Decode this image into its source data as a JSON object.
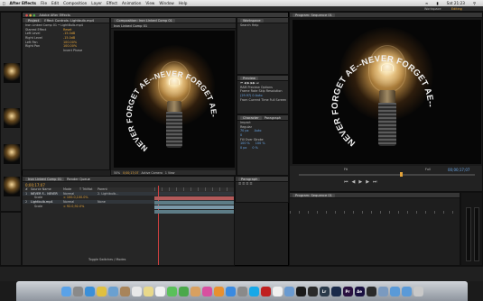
{
  "menubar": {
    "app": "After Effects",
    "items": [
      "File",
      "Edit",
      "Composition",
      "Layer",
      "Effect",
      "Animation",
      "View",
      "Window",
      "Help"
    ],
    "clock": "Sat 21:23"
  },
  "app_title": "Adobe After Effects",
  "workspace_label": "Workspace",
  "project_panel": {
    "title": "Project",
    "effect_tab": "Effect Controls: Lightbulb.mp4",
    "rows": [
      {
        "label": "Iron Linked Comp 01 • LightBulb.mp4",
        "value": ""
      },
      {
        "label": "Starred Effect",
        "value": "Reset"
      },
      {
        "label": "Left Level",
        "value": "-15.0dB"
      },
      {
        "label": "Right Level",
        "value": "-15.0dB"
      },
      {
        "label": "Left Pan",
        "value": "100.00%"
      },
      {
        "label": "Right Pan",
        "value": "100.00%"
      },
      {
        "label": "",
        "value": "Invert Phase"
      }
    ]
  },
  "comp_viewer": {
    "tab": "Composition: Iron Linked Comp 01",
    "sub_tab": "Iron Linked Comp 01",
    "arc_text": "NEVER FORGET AE--NEVER FORGET AE--NEVER",
    "zoom": "50%",
    "timecode": "0;00;17;07",
    "view": "Active Camera",
    "views": "1 View"
  },
  "info_panel": {
    "title": "Workspace",
    "rows": [
      "Search Help"
    ]
  },
  "preview_panel": {
    "title": "Preview",
    "rows": [
      "RAM Preview Options",
      "Frame Rate  Skip  Resolution",
      "(29.97)  0  Auto",
      "From Current Time   Full Screen"
    ]
  },
  "char_panel": {
    "title": "Character",
    "tab2": "Paragraph",
    "font": "Impact",
    "style": "Regular",
    "size": "70 px",
    "leading": "Auto",
    "tracking": "0",
    "stroke": "Fill Over Stroke",
    "scale_v": "100 %",
    "scale_h": "100 %",
    "baseline": "0 px",
    "tsume": "0 %"
  },
  "timeline": {
    "tab": "Iron Linked Comp 01",
    "tab2": "Render Queue",
    "timecode": "0;00;17;07",
    "columns": [
      "#",
      "Source Name",
      "Mode",
      "T TrkMat",
      "Parent"
    ],
    "layers": [
      {
        "num": "1",
        "name": "NEVER F... NEVER",
        "mode": "Normal",
        "parent": "2. Lightbulb..."
      },
      {
        "num": "2",
        "name": "Lightbulb.mp4",
        "mode": "Normal",
        "parent": "None"
      }
    ],
    "sub_rows": [
      "Scale",
      "Scale"
    ],
    "sub_values": [
      "∞ 100.0,100.0%",
      "∞ 92.0,92.0%"
    ],
    "footer": "Toggle Switches / Modes"
  },
  "premiere": {
    "workspace": "Workspace",
    "editing": "Editing",
    "sequence_timecode": "00;00;17;07",
    "program_tab": "Program: Sequence 01",
    "fit": "Fit",
    "full": "Full"
  },
  "dock": {
    "items": [
      {
        "name": "finder-icon",
        "label": "",
        "color": "#5aa2e8"
      },
      {
        "name": "launchpad-icon",
        "label": "",
        "color": "#8a8a8a"
      },
      {
        "name": "safari-icon",
        "label": "",
        "color": "#3b8fd8"
      },
      {
        "name": "chrome-icon",
        "label": "",
        "color": "#e0c040"
      },
      {
        "name": "mail-icon",
        "label": "",
        "color": "#6aa0d0"
      },
      {
        "name": "contacts-icon",
        "label": "",
        "color": "#a8845a"
      },
      {
        "name": "calendar-icon",
        "label": "",
        "color": "#e8e8e8"
      },
      {
        "name": "notes-icon",
        "label": "",
        "color": "#e8d88a"
      },
      {
        "name": "reminders-icon",
        "label": "",
        "color": "#f2f2f2"
      },
      {
        "name": "messages-icon",
        "label": "",
        "color": "#5ac05a"
      },
      {
        "name": "facetime-icon",
        "label": "",
        "color": "#4aa84a"
      },
      {
        "name": "photo-icon",
        "label": "",
        "color": "#d8a060"
      },
      {
        "name": "itunes-icon",
        "label": "",
        "color": "#d850a0"
      },
      {
        "name": "ibooks-icon",
        "label": "",
        "color": "#e89030"
      },
      {
        "name": "appstore-icon",
        "label": "",
        "color": "#3a8ae0"
      },
      {
        "name": "prefs-icon",
        "label": "",
        "color": "#8a8a8a"
      },
      {
        "name": "skype-icon",
        "label": "",
        "color": "#18a8e8"
      },
      {
        "name": "acrobat-icon",
        "label": "",
        "color": "#c02020"
      },
      {
        "name": "textedit-icon",
        "label": "",
        "color": "#f0f0f0"
      },
      {
        "name": "preview-icon",
        "label": "",
        "color": "#6a9ad0"
      },
      {
        "name": "terminal-icon",
        "label": "",
        "color": "#1a1a1a"
      },
      {
        "name": "activity-icon",
        "label": "",
        "color": "#2a2a2a"
      },
      {
        "name": "lightroom-icon",
        "label": "Lr",
        "color": "#2a3a4a"
      },
      {
        "name": "photoshop-icon",
        "label": "",
        "color": "#1a2a4a"
      },
      {
        "name": "premiere-icon",
        "label": "Pr",
        "color": "#2a1040"
      },
      {
        "name": "aftereffects-icon",
        "label": "Ae",
        "color": "#1a1040"
      },
      {
        "name": "media-encoder-icon",
        "label": "",
        "color": "#2a2a2a"
      },
      {
        "name": "downloads-icon",
        "label": "",
        "color": "#7a9ac0"
      },
      {
        "name": "folder-icon",
        "label": "",
        "color": "#5a9ad8"
      },
      {
        "name": "folder2-icon",
        "label": "",
        "color": "#5a9ad8"
      },
      {
        "name": "trash-icon",
        "label": "",
        "color": "#c8c8c8"
      }
    ]
  },
  "colors": {
    "ae_accent": "#e3a33a",
    "bg": "#1b1b1b",
    "panel": "#262626",
    "selected_layer": "#7a98a8"
  }
}
